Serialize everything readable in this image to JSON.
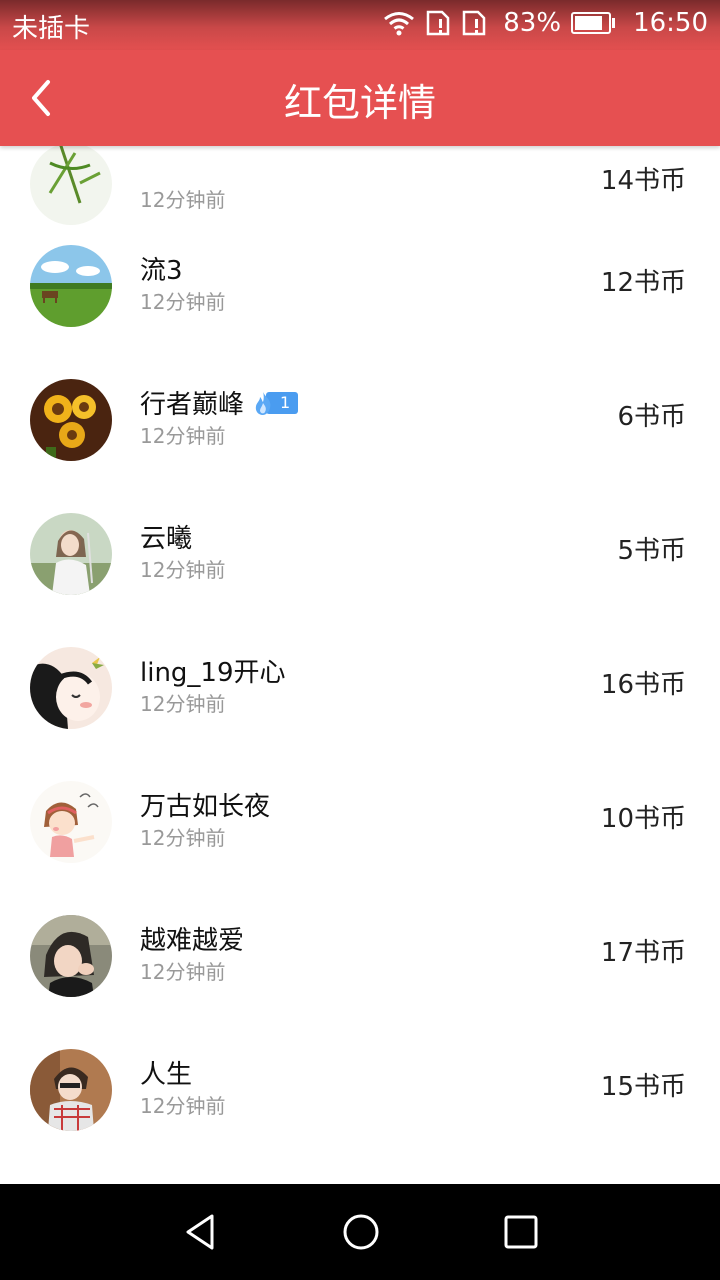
{
  "status_bar": {
    "carrier": "未插卡",
    "battery_percent": "83%",
    "battery_level": 0.83,
    "time": "16:50"
  },
  "header": {
    "title": "红包详情"
  },
  "records": [
    {
      "name": "",
      "time": "12分钟前",
      "amount": "14书币",
      "avatar": "bamboo"
    },
    {
      "name": "流3",
      "time": "12分钟前",
      "amount": "12书币",
      "avatar": "meadow-horse"
    },
    {
      "name": "行者巅峰",
      "time": "12分钟前",
      "amount": "6书币",
      "avatar": "sunflowers",
      "badge_level": "1"
    },
    {
      "name": "云曦",
      "time": "12分钟前",
      "amount": "5书币",
      "avatar": "girl-portrait"
    },
    {
      "name": "ling_19开心",
      "time": "12分钟前",
      "amount": "16书币",
      "avatar": "cartoon-girl"
    },
    {
      "name": "万古如长夜",
      "time": "12分钟前",
      "amount": "10书币",
      "avatar": "cartoon-biu"
    },
    {
      "name": "越难越爱",
      "time": "12分钟前",
      "amount": "17书币",
      "avatar": "child-photo"
    },
    {
      "name": "人生",
      "time": "12分钟前",
      "amount": "15书币",
      "avatar": "boy-photo"
    }
  ],
  "colors": {
    "header_red": "#e65051",
    "badge_blue": "#4a9cf0"
  }
}
